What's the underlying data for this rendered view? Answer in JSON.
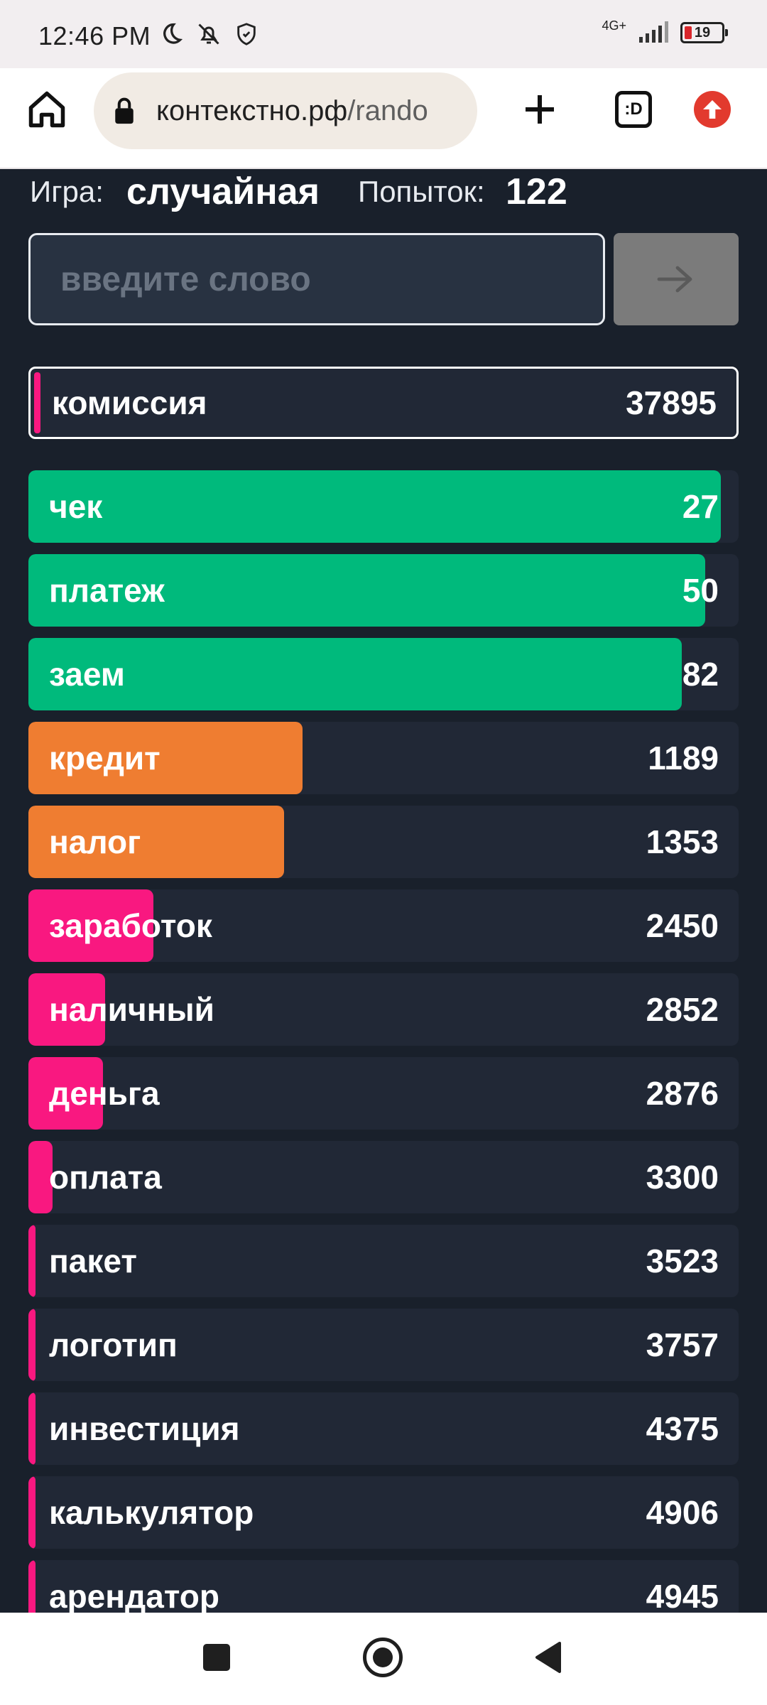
{
  "status_bar": {
    "time": "12:46 PM",
    "network": "4G+",
    "battery": "19",
    "icons": [
      "moon-icon",
      "bell-off-icon",
      "shield-icon",
      "signal-icon",
      "battery-icon"
    ]
  },
  "browser": {
    "url_host": "контекстно.рф",
    "url_path": "/rando",
    "tabs_label": ":D",
    "icons": [
      "home-icon",
      "lock-icon",
      "plus-icon",
      "update-icon"
    ]
  },
  "game": {
    "game_label": "Игра:",
    "game_value": "случайная",
    "attempts_label": "Попыток:",
    "attempts_value": "122",
    "input_placeholder": "введите слово",
    "submit_icon": "arrow-right-icon",
    "latest": {
      "word": "комиссия",
      "rank": "37895",
      "fill": 0.01
    },
    "guesses": [
      {
        "word": "чек",
        "rank": "27",
        "fill": 0.975,
        "color": "#00ba7c"
      },
      {
        "word": "платеж",
        "rank": "50",
        "fill": 0.953,
        "color": "#00ba7c"
      },
      {
        "word": "заем",
        "rank": "82",
        "fill": 0.92,
        "color": "#00ba7c"
      },
      {
        "word": "кредит",
        "rank": "1189",
        "fill": 0.386,
        "color": "#ef7d31"
      },
      {
        "word": "налог",
        "rank": "1353",
        "fill": 0.36,
        "color": "#ef7d31"
      },
      {
        "word": "заработок",
        "rank": "2450",
        "fill": 0.176,
        "color": "#f91880"
      },
      {
        "word": "наличный",
        "rank": "2852",
        "fill": 0.108,
        "color": "#f91880"
      },
      {
        "word": "деньга",
        "rank": "2876",
        "fill": 0.105,
        "color": "#f91880"
      },
      {
        "word": "оплата",
        "rank": "3300",
        "fill": 0.034,
        "color": "#f91880"
      },
      {
        "word": "пакет",
        "rank": "3523",
        "fill": 0.01,
        "color": "#f91880"
      },
      {
        "word": "логотип",
        "rank": "3757",
        "fill": 0.01,
        "color": "#f91880"
      },
      {
        "word": "инвестиция",
        "rank": "4375",
        "fill": 0.01,
        "color": "#f91880"
      },
      {
        "word": "калькулятор",
        "rank": "4906",
        "fill": 0.01,
        "color": "#f91880"
      },
      {
        "word": "арендатор",
        "rank": "4945",
        "fill": 0.01,
        "color": "#f91880"
      }
    ]
  },
  "nav_bar": {
    "icons": [
      "recents-icon",
      "home-circle-icon",
      "back-icon"
    ]
  }
}
